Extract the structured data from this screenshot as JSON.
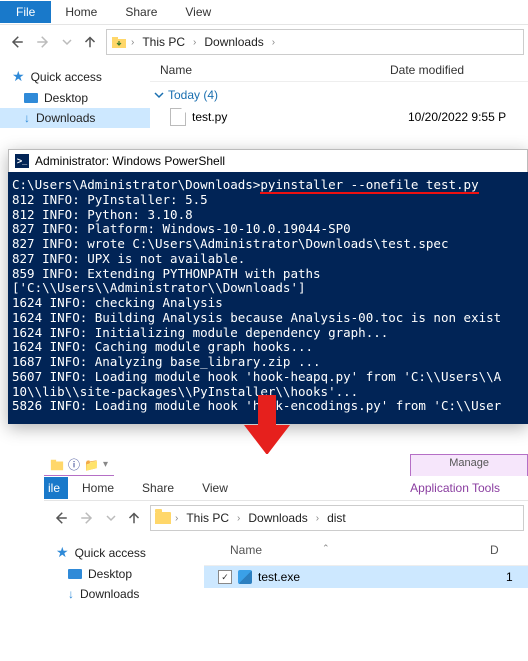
{
  "explorer1": {
    "tabs": {
      "file": "File",
      "home": "Home",
      "share": "Share",
      "view": "View"
    },
    "breadcrumb": {
      "root": "This PC",
      "folder": "Downloads"
    },
    "columns": {
      "name": "Name",
      "date": "Date modified"
    },
    "group_label": "Today (4)",
    "file": {
      "name": "test.py",
      "date": "10/20/2022 9:55 P"
    },
    "sidebar": {
      "quick": "Quick access",
      "desktop": "Desktop",
      "downloads": "Downloads"
    }
  },
  "powershell": {
    "title": "Administrator: Windows PowerShell",
    "prompt_path": "C:\\Users\\Administrator\\Downloads>",
    "command": "pyinstaller --onefile test.py",
    "lines": [
      "812 INFO: PyInstaller: 5.5",
      "812 INFO: Python: 3.10.8",
      "827 INFO: Platform: Windows-10-10.0.19044-SP0",
      "827 INFO: wrote C:\\Users\\Administrator\\Downloads\\test.spec",
      "827 INFO: UPX is not available.",
      "859 INFO: Extending PYTHONPATH with paths",
      "['C:\\\\Users\\\\Administrator\\\\Downloads']",
      "1624 INFO: checking Analysis",
      "1624 INFO: Building Analysis because Analysis-00.toc is non exist",
      "1624 INFO: Initializing module dependency graph...",
      "1624 INFO: Caching module graph hooks...",
      "1687 INFO: Analyzing base_library.zip ...",
      "5607 INFO: Loading module hook 'hook-heapq.py' from 'C:\\\\Users\\\\A",
      "10\\\\lib\\\\site-packages\\\\PyInstaller\\\\hooks'...",
      "5826 INFO: Loading module hook 'hook-encodings.py' from 'C:\\\\User"
    ]
  },
  "explorer2": {
    "manage": "Manage",
    "app_tools": "Application Tools",
    "tabs": {
      "file": "ile",
      "home": "Home",
      "share": "Share",
      "view": "View"
    },
    "breadcrumb": {
      "root": "This PC",
      "folder": "Downloads",
      "sub": "dist"
    },
    "columns": {
      "name": "Name",
      "d": "D"
    },
    "file": {
      "name": "test.exe",
      "d": "1"
    },
    "sidebar": {
      "quick": "Quick access",
      "desktop": "Desktop",
      "downloads": "Downloads"
    }
  }
}
